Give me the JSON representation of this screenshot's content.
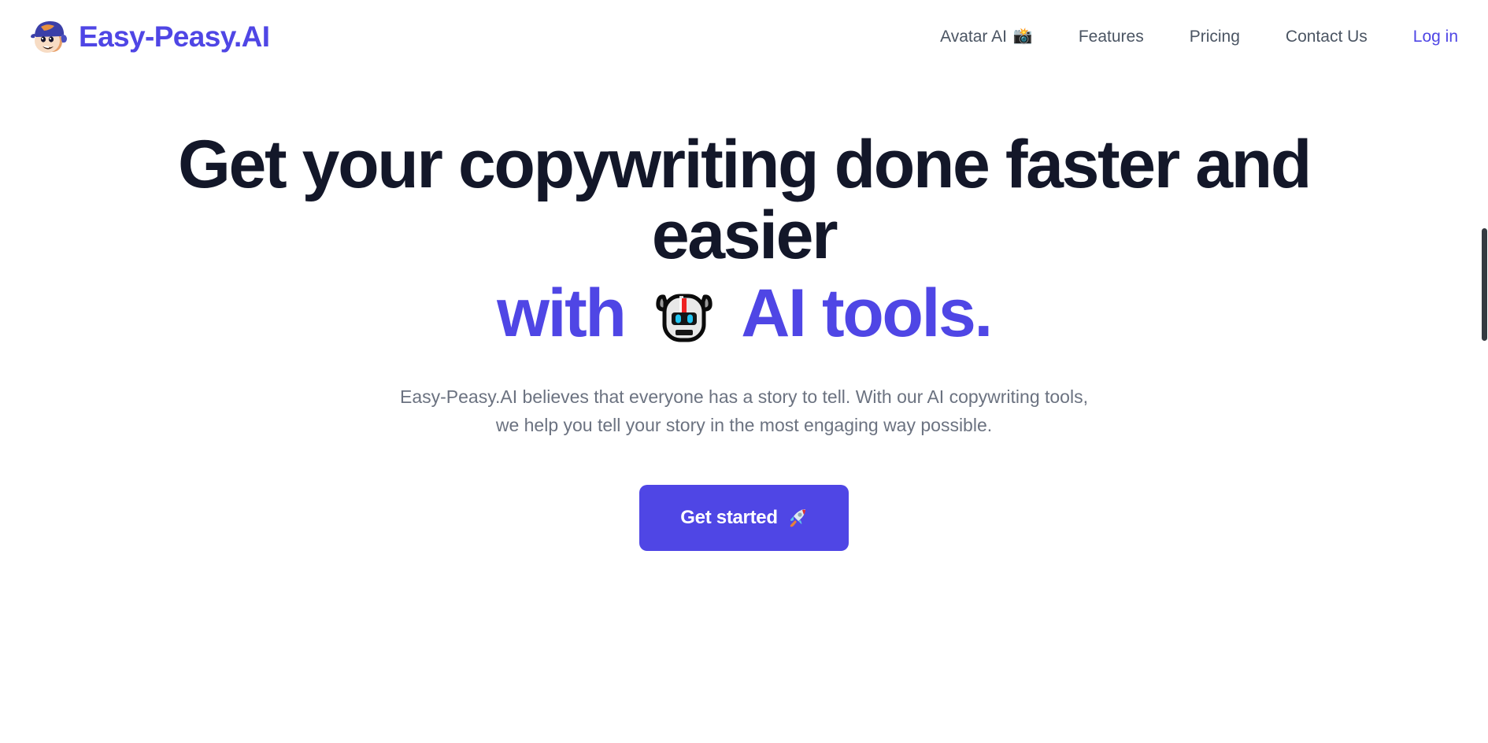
{
  "brand": {
    "name": "Easy-Peasy.AI",
    "logo_icon": "avatar-face-cap-icon",
    "accent_color": "#4f46e5"
  },
  "nav": {
    "items": [
      {
        "label": "Avatar AI",
        "emoji": "📸",
        "emoji_name": "camera-with-flash-icon",
        "accent": false
      },
      {
        "label": "Features",
        "emoji": "",
        "emoji_name": "",
        "accent": false
      },
      {
        "label": "Pricing",
        "emoji": "",
        "emoji_name": "",
        "accent": false
      },
      {
        "label": "Contact Us",
        "emoji": "",
        "emoji_name": "",
        "accent": false
      },
      {
        "label": "Log in",
        "emoji": "",
        "emoji_name": "",
        "accent": true
      }
    ]
  },
  "hero": {
    "title_line_1": "Get your copywriting done faster and",
    "title_line_2": "easier",
    "accent_pre": "with",
    "accent_post": "AI tools.",
    "robot_icon": "robot-face-icon",
    "subtitle": "Easy-Peasy.AI believes that everyone has a story to tell. With our AI copywriting tools, we help you tell your story in the most engaging way possible.",
    "cta_label": "Get started",
    "cta_emoji": "🚀",
    "cta_emoji_name": "rocket-icon"
  },
  "colors": {
    "heading": "#131729",
    "accent": "#4f46e5",
    "body_text": "#6b7280",
    "nav_text": "#4b5563",
    "background": "#ffffff",
    "scrollbar_thumb": "#343a40"
  },
  "scrollbar": {
    "name": "vertical-scrollbar"
  }
}
